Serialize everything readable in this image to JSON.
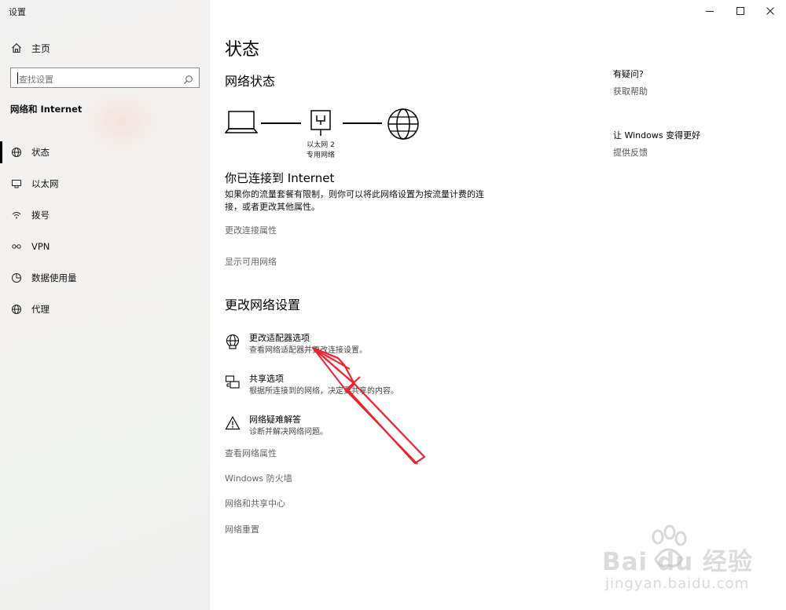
{
  "window": {
    "title": "设置"
  },
  "sidebar": {
    "home_label": "主页",
    "search_placeholder": "查找设置",
    "section_title": "网络和 Internet",
    "items": [
      {
        "label": "状态",
        "icon": "home-globe-icon",
        "active": true
      },
      {
        "label": "以太网",
        "icon": "ethernet-icon",
        "active": false
      },
      {
        "label": "拨号",
        "icon": "dialup-icon",
        "active": false
      },
      {
        "label": "VPN",
        "icon": "vpn-icon",
        "active": false
      },
      {
        "label": "数据使用量",
        "icon": "data-usage-icon",
        "active": false
      },
      {
        "label": "代理",
        "icon": "globe-icon",
        "active": false
      }
    ]
  },
  "main": {
    "title": "状态",
    "network_status_heading": "网络状态",
    "adapter_name": "以太网 2",
    "adapter_network": "专用网络",
    "connected_text": "你已连接到 Internet",
    "connected_desc": "如果你的流量套餐有限制，则你可以将此网络设置为按流量计费的连接，或者更改其他属性。",
    "link_change_props": "更改连接属性",
    "link_show_networks": "显示可用网络",
    "change_settings_heading": "更改网络设置",
    "settings": [
      {
        "title": "更改适配器选项",
        "subtitle": "查看网络适配器并更改连接设置。",
        "icon": "adapter-globe-icon"
      },
      {
        "title": "共享选项",
        "subtitle": "根据所连接到的网络，决定要共享的内容。",
        "icon": "sharing-icon"
      },
      {
        "title": "网络疑难解答",
        "subtitle": "诊断并解决网络问题。",
        "icon": "warning-icon"
      }
    ],
    "bottom_links": [
      "查看网络属性",
      "Windows 防火墙",
      "网络和共享中心",
      "网络重置"
    ]
  },
  "help": {
    "question_title": "有疑问?",
    "question_link": "获取帮助",
    "improve_title": "让 Windows 变得更好",
    "improve_link": "提供反馈"
  },
  "watermark": {
    "brand": "Bai du 经验",
    "url": "jingyan.baidu.com"
  },
  "colors": {
    "annotation_arrow": "#e8242e",
    "sidebar_bg": "#f1f1f1"
  }
}
